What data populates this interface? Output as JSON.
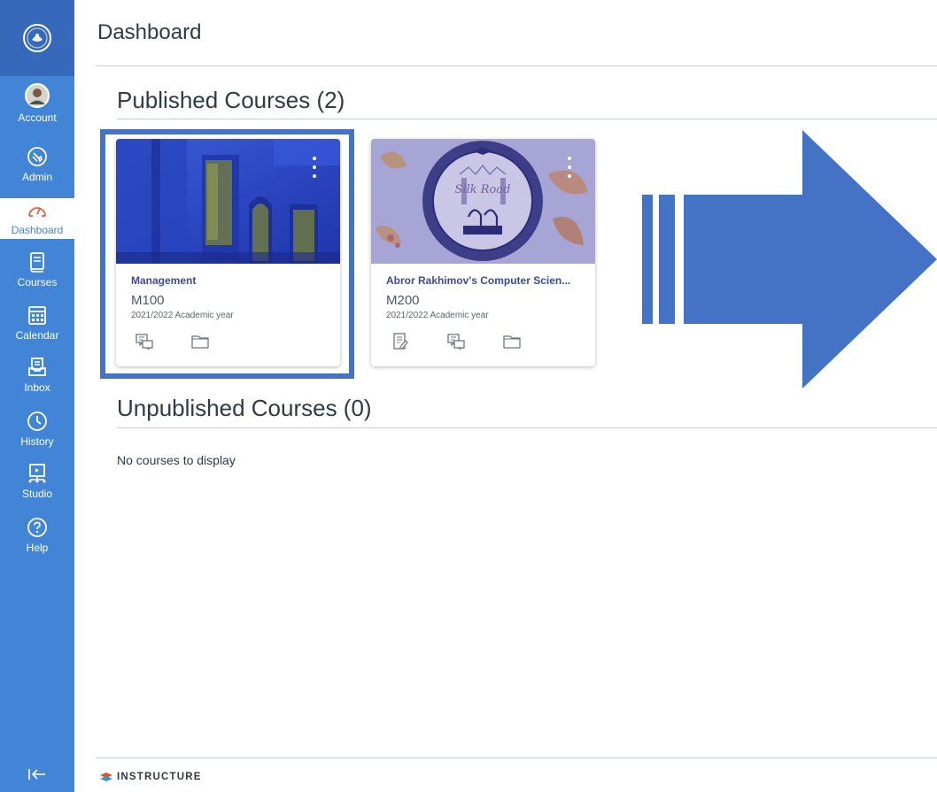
{
  "nav": {
    "items": [
      {
        "label": "Account",
        "icon": "avatar"
      },
      {
        "label": "Admin",
        "icon": "shield-icon"
      },
      {
        "label": "Dashboard",
        "icon": "speedometer-icon"
      },
      {
        "label": "Courses",
        "icon": "book-icon"
      },
      {
        "label": "Calendar",
        "icon": "calendar-icon"
      },
      {
        "label": "Inbox",
        "icon": "inbox-icon"
      },
      {
        "label": "History",
        "icon": "clock-icon"
      },
      {
        "label": "Studio",
        "icon": "studio-icon"
      },
      {
        "label": "Help",
        "icon": "question-icon"
      }
    ],
    "active": "Dashboard",
    "colors": {
      "background": "#4285d6",
      "logo_background": "#3669ba",
      "active_text": "#4285d6"
    }
  },
  "page": {
    "title": "Dashboard"
  },
  "published": {
    "heading": "Published Courses (2)",
    "courses": [
      {
        "name": "Management",
        "code": "M100",
        "term": "2021/2022 Academic year",
        "actions": [
          "announcements-icon",
          "files-icon"
        ],
        "hero_color": "#2f4ec9"
      },
      {
        "name": "Abror Rakhimov's Computer Scien...",
        "code": "M200",
        "term": "2021/2022 Academic year",
        "actions": [
          "assignments-icon",
          "announcements-icon",
          "files-icon"
        ],
        "hero_color": "#7b79c8"
      }
    ]
  },
  "unpublished": {
    "heading": "Unpublished Courses (0)",
    "empty_message": "No courses to display"
  },
  "footer": {
    "brand": "INSTRUCTURE"
  },
  "annotation": {
    "highlight_color": "#4472c4",
    "arrow_color": "#4472c4"
  }
}
